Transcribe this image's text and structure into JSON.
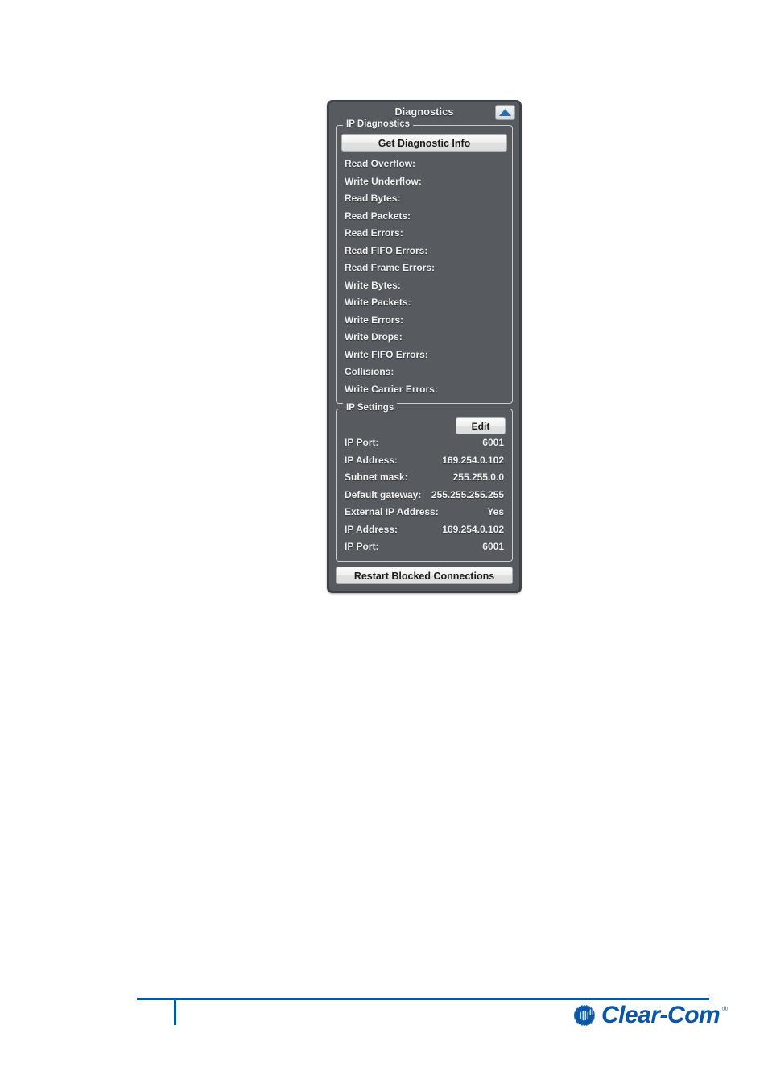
{
  "panel": {
    "title": "Diagnostics",
    "collapse_icon": "collapse-triangle-up-icon",
    "accent_color": "#2e6da4",
    "background_color": "#575a5f"
  },
  "ip_diagnostics": {
    "legend": "IP Diagnostics",
    "get_info_button": "Get Diagnostic Info",
    "rows": [
      {
        "label": "Read Overflow:",
        "value": ""
      },
      {
        "label": "Write Underflow:",
        "value": ""
      },
      {
        "label": "Read Bytes:",
        "value": ""
      },
      {
        "label": "Read Packets:",
        "value": ""
      },
      {
        "label": "Read Errors:",
        "value": ""
      },
      {
        "label": "Read FIFO Errors:",
        "value": ""
      },
      {
        "label": "Read Frame Errors:",
        "value": ""
      },
      {
        "label": "Write Bytes:",
        "value": ""
      },
      {
        "label": "Write Packets:",
        "value": ""
      },
      {
        "label": "Write Errors:",
        "value": ""
      },
      {
        "label": "Write Drops:",
        "value": ""
      },
      {
        "label": "Write FIFO Errors:",
        "value": ""
      },
      {
        "label": "Collisions:",
        "value": ""
      },
      {
        "label": "Write Carrier Errors:",
        "value": ""
      }
    ]
  },
  "ip_settings": {
    "legend": "IP Settings",
    "edit_button": "Edit",
    "rows": [
      {
        "label": "IP Port:",
        "value": "6001"
      },
      {
        "label": "IP Address:",
        "value": "169.254.0.102"
      },
      {
        "label": "Subnet mask:",
        "value": "255.255.0.0"
      },
      {
        "label": "Default gateway:",
        "value": "255.255.255.255"
      },
      {
        "label": "External IP Address:",
        "value": "Yes"
      },
      {
        "label": "IP Address:",
        "value": "169.254.0.102"
      },
      {
        "label": "IP Port:",
        "value": "6001"
      }
    ]
  },
  "restart_button": "Restart Blocked Connections",
  "footer": {
    "brand": "Clear-Com",
    "trademark": "®",
    "rule_color": "#005ca9"
  }
}
